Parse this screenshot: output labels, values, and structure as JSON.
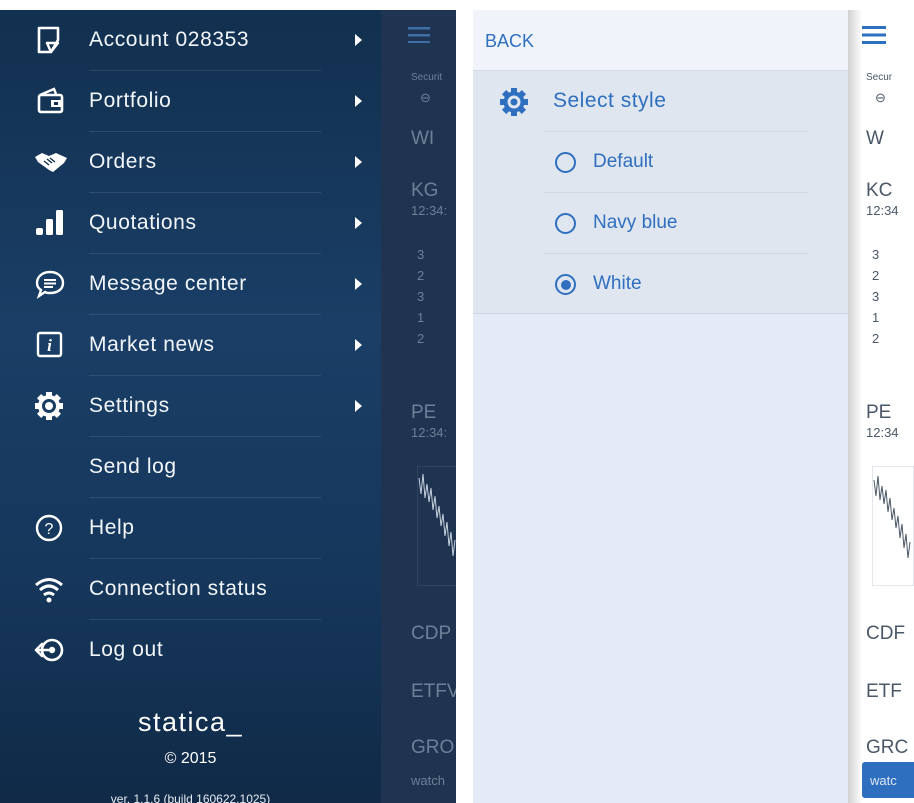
{
  "left_menu": {
    "items": [
      {
        "label": "Account 028353",
        "icon": "account-icon",
        "has_arrow": true
      },
      {
        "label": "Portfolio",
        "icon": "wallet-icon",
        "has_arrow": true
      },
      {
        "label": "Orders",
        "icon": "handshake-icon",
        "has_arrow": true
      },
      {
        "label": "Quotations",
        "icon": "bar-chart-icon",
        "has_arrow": true
      },
      {
        "label": "Message center",
        "icon": "chat-bubble-icon",
        "has_arrow": true
      },
      {
        "label": "Market news",
        "icon": "info-icon",
        "has_arrow": true
      },
      {
        "label": "Settings",
        "icon": "gear-icon",
        "has_arrow": true
      },
      {
        "label": "Send log",
        "icon": "",
        "has_arrow": false
      },
      {
        "label": "Help",
        "icon": "help-icon",
        "has_arrow": false
      },
      {
        "label": "Connection status",
        "icon": "wifi-icon",
        "has_arrow": false
      },
      {
        "label": "Log out",
        "icon": "logout-icon",
        "has_arrow": false
      }
    ],
    "brand": "statica_",
    "copyright": "© 2015",
    "version": "ver. 1.1.6 (build 160622.1025)"
  },
  "left_background": {
    "texts": [
      "Securit",
      "WI",
      "KG",
      "12:34:",
      "3",
      "2",
      "3",
      "1",
      "2",
      "PE",
      "12:34:",
      "CDP",
      "ETFV",
      "GRO",
      "watch"
    ]
  },
  "middle": {
    "back_label": "BACK",
    "title": "Select style",
    "title_icon": "gear-icon",
    "options": [
      {
        "label": "Default",
        "selected": false
      },
      {
        "label": "Navy blue",
        "selected": false
      },
      {
        "label": "White",
        "selected": true
      }
    ],
    "accent_color": "#2f6fbf"
  },
  "right_background": {
    "texts": [
      "Secur",
      "W",
      "KC",
      "12:34",
      "3",
      "2",
      "3",
      "1",
      "2",
      "PE",
      "12:34",
      "CDF",
      "ETF",
      "GRC",
      "watc"
    ]
  }
}
